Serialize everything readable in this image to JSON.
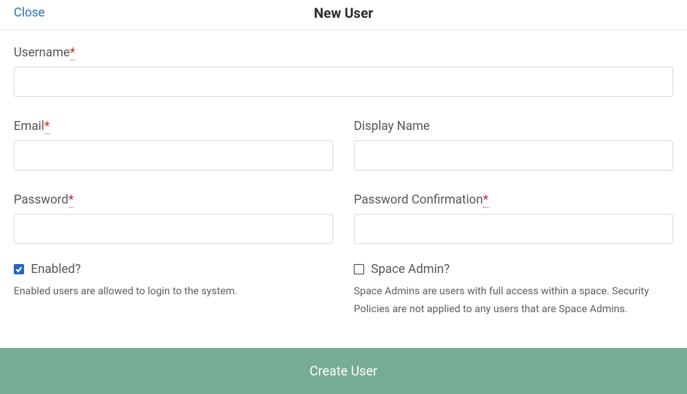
{
  "header": {
    "close_label": "Close",
    "title": "New User"
  },
  "fields": {
    "username": {
      "label": "Username",
      "required_mark": "*",
      "value": ""
    },
    "email": {
      "label": "Email",
      "required_mark": "*",
      "value": ""
    },
    "display_name": {
      "label": "Display Name",
      "value": ""
    },
    "password": {
      "label": "Password",
      "required_mark": "*",
      "value": ""
    },
    "password_confirmation": {
      "label": "Password Confirmation",
      "required_mark": "*",
      "value": ""
    }
  },
  "checks": {
    "enabled": {
      "label": "Enabled?",
      "checked": true,
      "help": "Enabled users are allowed to login to the system."
    },
    "space_admin": {
      "label": "Space Admin?",
      "checked": false,
      "help": "Space Admins are users with full access within a space. Security Policies are not applied to any users that are Space Admins."
    }
  },
  "submit": {
    "label": "Create User"
  }
}
